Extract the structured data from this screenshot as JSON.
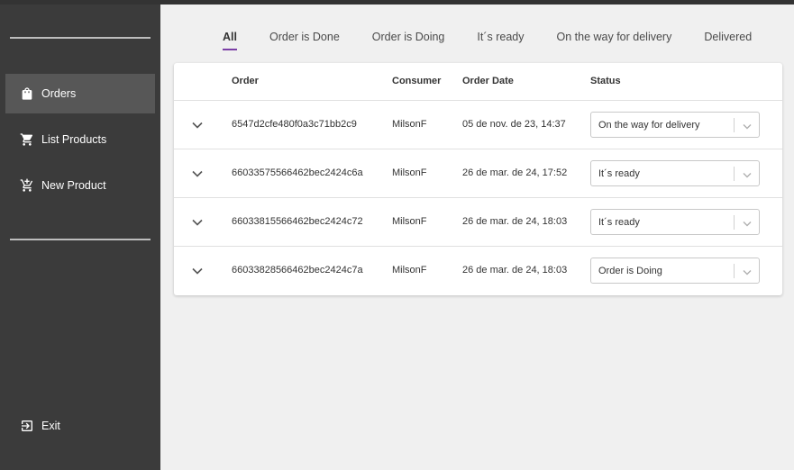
{
  "sidebar": {
    "items": [
      {
        "label": "Orders",
        "icon": "shopping-bag-icon"
      },
      {
        "label": "List Products",
        "icon": "cart-icon"
      },
      {
        "label": "New Product",
        "icon": "add-cart-icon"
      }
    ],
    "exit_label": "Exit"
  },
  "tabs": [
    "All",
    "Order is Done",
    "Order is Doing",
    "It´s ready",
    "On the way for delivery",
    "Delivered"
  ],
  "table": {
    "headers": [
      "Order",
      "Consumer",
      "Order Date",
      "Status"
    ],
    "rows": [
      {
        "order": "6547d2cfe480f0a3c71bb2c9",
        "consumer": "MilsonF",
        "date": "05 de nov. de 23, 14:37",
        "status": "On the way for delivery"
      },
      {
        "order": "66033575566462bec2424c6a",
        "consumer": "MilsonF",
        "date": "26 de mar. de 24, 17:52",
        "status": "It´s ready"
      },
      {
        "order": "66033815566462bec2424c72",
        "consumer": "MilsonF",
        "date": "26 de mar. de 24, 18:03",
        "status": "It´s ready"
      },
      {
        "order": "66033828566462bec2424c7a",
        "consumer": "MilsonF",
        "date": "26 de mar. de 24, 18:03",
        "status": "Order is Doing"
      }
    ]
  },
  "colors": {
    "sidebar": "#3b3b3b",
    "active_nav": "#575757",
    "tab_indicator": "#7b3fa6",
    "background": "#f0f0f0"
  }
}
